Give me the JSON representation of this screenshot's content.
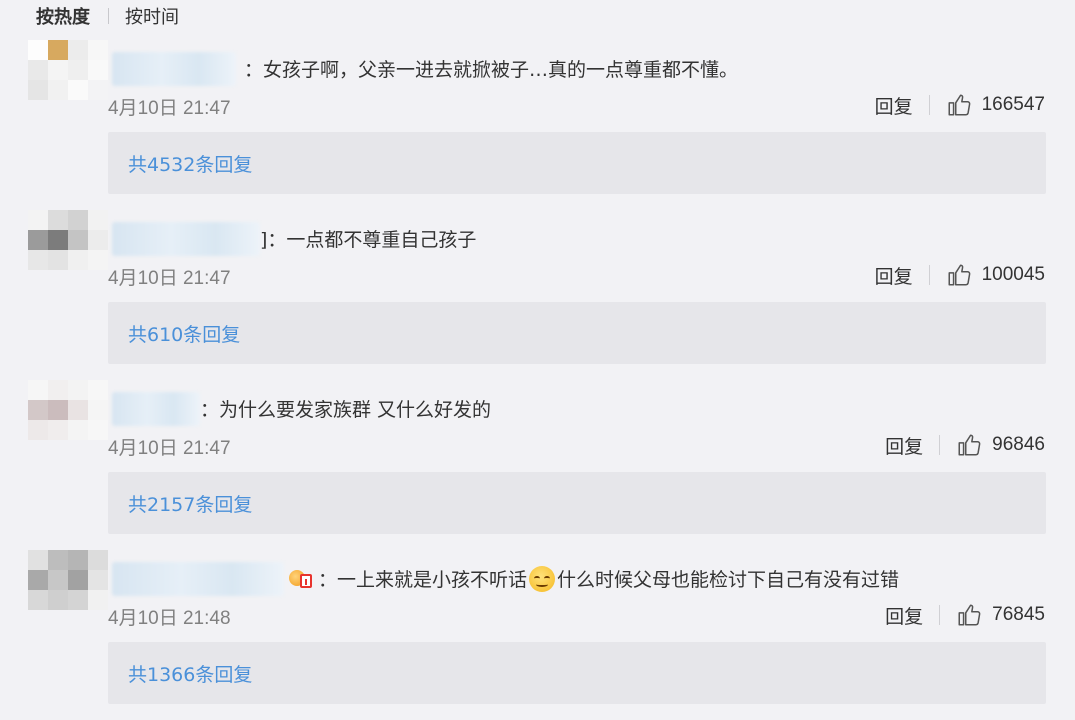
{
  "sort": {
    "hot": "按热度",
    "time": "按时间"
  },
  "comments": [
    {
      "text": "：女孩子啊，父亲一进去就掀被子…真的一点尊重都不懂。",
      "time": "4月10日 21:47",
      "reply": "回复",
      "likes": "166547",
      "replies": "共4532条回复"
    },
    {
      "text": "]：一点都不尊重自己孩子",
      "time": "4月10日 21:47",
      "reply": "回复",
      "likes": "100045",
      "replies": "共610条回复"
    },
    {
      "text": "：为什么要发家族群 又什么好发的",
      "time": "4月10日 21:47",
      "reply": "回复",
      "likes": "96846",
      "replies": "共2157条回复"
    },
    {
      "text_a": "：一上来就是小孩不听话",
      "text_b": "什么时候父母也能检讨下自己有没有过错",
      "time": "4月10日 21:48",
      "reply": "回复",
      "likes": "76845",
      "replies": "共1366条回复"
    }
  ],
  "icons": {
    "like": "thumbs-up-icon",
    "emoji": "smiley-emoji-icon",
    "badge": "fan-badge-icon"
  },
  "colors": {
    "link": "#4a90d9",
    "muted": "#808080",
    "box": "#e6e6ea"
  }
}
